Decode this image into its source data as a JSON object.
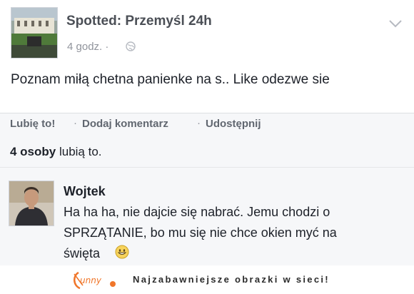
{
  "post": {
    "page_name": "Spotted: Przemyśl 24h",
    "time": "4 godz. ·",
    "text": "Poznam miłą chetna panienke na s.. Like odezwe sie"
  },
  "actions": {
    "like": "Lubię to!",
    "comment": "Dodaj komentarz",
    "share": "Udostępnij",
    "separator": "·"
  },
  "likes": {
    "count": "4 osoby",
    "suffix": " lubią to."
  },
  "comment": {
    "author": "Wojtek",
    "lines": [
      "Ha ha ha, nie dajcie się nabrać. Jemu chodzi o",
      "SPRZĄTANIE, bo mu się nie chce okien myć na",
      "święta"
    ]
  },
  "footer": {
    "logo_text": "Funny",
    "slogan": "Najzabawniejsze obrazki w sieci!"
  },
  "icons": {
    "globe": "globe-icon",
    "chevron": "chevron-down-icon",
    "smiley": "smiley-icon"
  },
  "colors": {
    "page_name": "#4b4f56",
    "muted": "#90949c",
    "action_bar_bg": "#f6f7f9",
    "text": "#1d2129",
    "logo_orange": "#f0762a"
  }
}
